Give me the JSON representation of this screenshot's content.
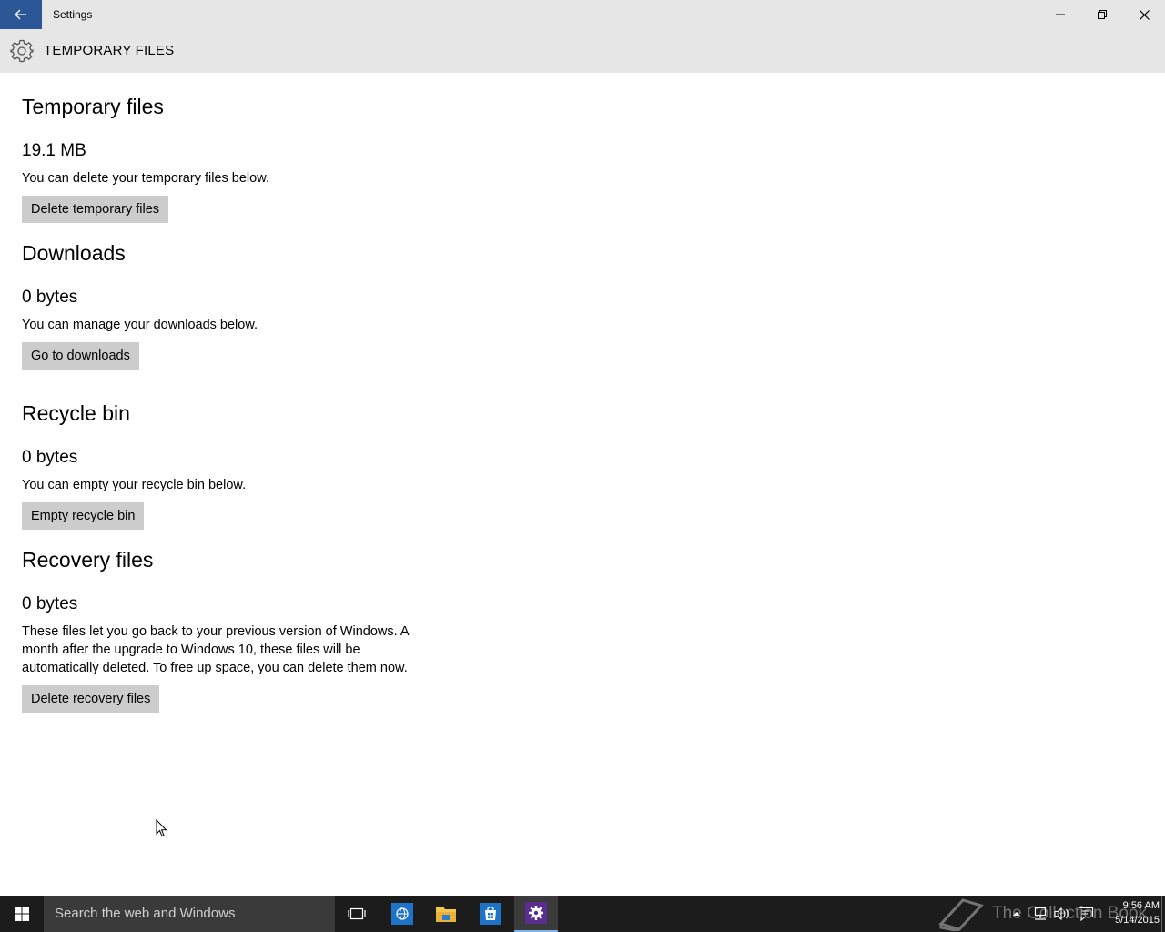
{
  "window": {
    "title": "Settings",
    "page_title": "TEMPORARY FILES"
  },
  "sections": [
    {
      "title": "Temporary files",
      "size": "19.1 MB",
      "description": "You can delete your temporary files below.",
      "button": "Delete temporary files"
    },
    {
      "title": "Downloads",
      "size": "0 bytes",
      "description": "You can manage your downloads below.",
      "button": "Go to downloads"
    },
    {
      "title": "Recycle bin",
      "size": "0 bytes",
      "description": "You can empty your recycle bin below.",
      "button": "Empty recycle bin"
    },
    {
      "title": "Recovery files",
      "size": "0 bytes",
      "description": "These files let you go back to your previous version of Windows. A month after the upgrade to Windows 10, these files will be automatically deleted. To free up space, you can delete them now.",
      "button": "Delete recovery files"
    }
  ],
  "taskbar": {
    "search_placeholder": "Search the web and Windows",
    "watermark": "The Collection Book",
    "time": "9:56 AM",
    "date": "5/14/2015",
    "colors": {
      "background": "#1c1c1c",
      "accent": "#2b5797",
      "settings_icon_bg": "#5c2d91"
    }
  }
}
